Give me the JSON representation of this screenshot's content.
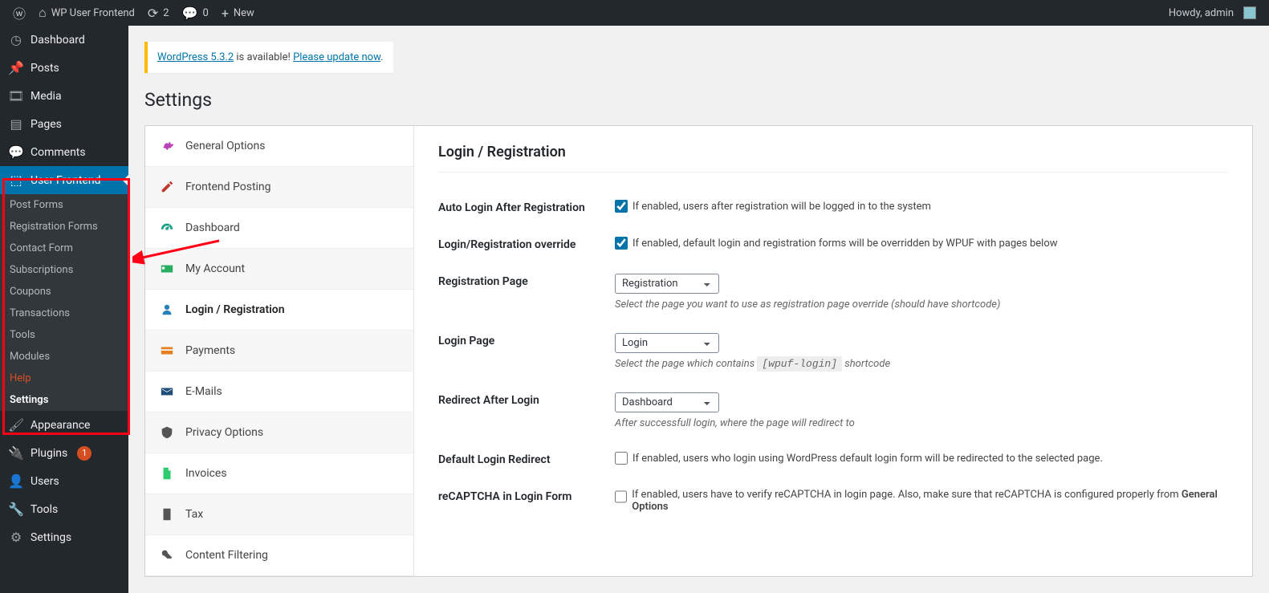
{
  "toolbar": {
    "site_name": "WP User Frontend",
    "update_count": "2",
    "comment_count": "0",
    "new_label": "New",
    "howdy": "Howdy, admin"
  },
  "sidebar": {
    "items": [
      {
        "label": "Dashboard",
        "icon": "◷"
      },
      {
        "label": "Posts",
        "icon": "📌"
      },
      {
        "label": "Media",
        "icon": "🎞"
      },
      {
        "label": "Pages",
        "icon": "▤"
      },
      {
        "label": "Comments",
        "icon": "💬"
      },
      {
        "label": "User Frontend",
        "icon": "⬚",
        "current": true
      },
      {
        "label": "Appearance",
        "icon": "🖌"
      },
      {
        "label": "Plugins",
        "icon": "🔌",
        "badge": "1"
      },
      {
        "label": "Users",
        "icon": "👤"
      },
      {
        "label": "Tools",
        "icon": "🔧"
      },
      {
        "label": "Settings",
        "icon": "⚙"
      }
    ],
    "submenu": [
      {
        "label": "Post Forms"
      },
      {
        "label": "Registration Forms"
      },
      {
        "label": "Contact Form"
      },
      {
        "label": "Subscriptions"
      },
      {
        "label": "Coupons"
      },
      {
        "label": "Transactions"
      },
      {
        "label": "Tools"
      },
      {
        "label": "Modules"
      },
      {
        "label": "Help",
        "help": true
      },
      {
        "label": "Settings",
        "active": true
      }
    ]
  },
  "notice": {
    "version_link": "WordPress 5.3.2",
    "middle": " is available! ",
    "update_link": "Please update now",
    "tail": "."
  },
  "page_title": "Settings",
  "tabs": [
    {
      "label": "General Options",
      "color": "#b743b7",
      "icon": "gear"
    },
    {
      "label": "Frontend Posting",
      "color": "#c0392b",
      "icon": "pencil"
    },
    {
      "label": "Dashboard",
      "color": "#16a085",
      "icon": "gauge"
    },
    {
      "label": "My Account",
      "color": "#27ae60",
      "icon": "id"
    },
    {
      "label": "Login / Registration",
      "color": "#2980b9",
      "icon": "user",
      "active": true
    },
    {
      "label": "Payments",
      "color": "#e67e22",
      "icon": "card"
    },
    {
      "label": "E-Mails",
      "color": "#1f4e79",
      "icon": "mail"
    },
    {
      "label": "Privacy Options",
      "color": "#555",
      "icon": "shield"
    },
    {
      "label": "Invoices",
      "color": "#2ecc71",
      "icon": "doc"
    },
    {
      "label": "Tax",
      "color": "#555",
      "icon": "doc2"
    },
    {
      "label": "Content Filtering",
      "color": "#555",
      "icon": "key"
    }
  ],
  "content_heading": "Login / Registration",
  "fields": {
    "auto_login": {
      "label": "Auto Login After Registration",
      "checked": true,
      "text": "If enabled, users after registration will be logged in to the system"
    },
    "override": {
      "label": "Login/Registration override",
      "checked": true,
      "text": "If enabled, default login and registration forms will be overridden by WPUF with pages below"
    },
    "reg_page": {
      "label": "Registration Page",
      "value": "Registration",
      "desc": "Select the page you want to use as registration page override (should have shortcode)"
    },
    "login_page": {
      "label": "Login Page",
      "value": "Login",
      "desc_pre": "Select the page which contains ",
      "code": "[wpuf-login]",
      "desc_post": " shortcode"
    },
    "redirect": {
      "label": "Redirect After Login",
      "value": "Dashboard",
      "desc": "After successfull login, where the page will redirect to"
    },
    "default_redirect": {
      "label": "Default Login Redirect",
      "checked": false,
      "text": "If enabled, users who login using WordPress default login form will be redirected to the selected page."
    },
    "recaptcha": {
      "label": "reCAPTCHA in Login Form",
      "checked": false,
      "text": "If enabled, users have to verify reCAPTCHA in login page. Also, make sure that reCAPTCHA is configured properly from ",
      "bold": "General Options"
    }
  }
}
